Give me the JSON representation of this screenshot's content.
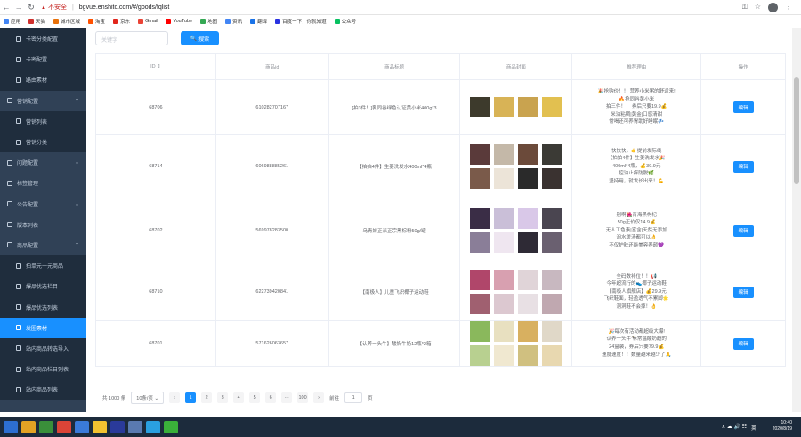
{
  "browser": {
    "insecure_label": "不安全",
    "url": "bgvue.enshitc.com/#/goods/fqlist"
  },
  "bookmarks": [
    "应用",
    "天猫",
    "城市区域",
    "淘宝",
    "京东",
    "Gmail",
    "YouTube",
    "地图",
    "资讯",
    "翻译",
    "百度一下，你就知道",
    "公众号"
  ],
  "sidebar": [
    {
      "label": "卡密分类配置",
      "level": 2
    },
    {
      "label": "卡密配置",
      "level": 2
    },
    {
      "label": "路由素材",
      "level": 2
    },
    {
      "label": "营销配置",
      "level": 1,
      "arrow": "⌃"
    },
    {
      "label": "营销列表",
      "level": 2
    },
    {
      "label": "营销分类",
      "level": 2
    },
    {
      "label": "问题配置",
      "level": 1,
      "arrow": "⌄"
    },
    {
      "label": "标签管理",
      "level": 1
    },
    {
      "label": "公告配置",
      "level": 1,
      "arrow": "⌄"
    },
    {
      "label": "版本列表",
      "level": 1
    },
    {
      "label": "商品配置",
      "level": 1,
      "arrow": "⌃"
    },
    {
      "label": "拍单元一元商品",
      "level": 2
    },
    {
      "label": "爆品优选栏目",
      "level": 2
    },
    {
      "label": "爆品优选列表",
      "level": 2
    },
    {
      "label": "发圈素材",
      "level": 2,
      "active": true
    },
    {
      "label": "站内商品转选导入",
      "level": 2
    },
    {
      "label": "站内商品栏目列表",
      "level": 2
    },
    {
      "label": "站内商品列表",
      "level": 2
    }
  ],
  "search": {
    "placeholder": "关键字",
    "button": "搜索"
  },
  "table": {
    "headers": [
      "ID ⇕",
      "商品id",
      "商品标题",
      "商品封面",
      "推荐理由",
      "操作"
    ],
    "rows": [
      {
        "id": "68706",
        "gid": "610282707167",
        "title": "[拍3件！]乳同谷绿色认证黄小米400g*3",
        "reason": "🎉抢购价！！ 营养小米粥的舒适来!\n🔥抢同谷黄小米\n拍三件！！ 券后只要19.9💰\n米油粘稠|黄金|口感清甜\n常喝还可养胃助好睡眠💤",
        "btn": "编辑",
        "imgs": [
          "#3d3a2c",
          "#d8b356",
          "#c9a34f",
          "#e2c050"
        ]
      },
      {
        "id": "68714",
        "gid": "606988885261",
        "title": "【拍拍4件】生姜洗发水400ml*4瓶",
        "reason": "快快快，👉提前发际线\n【拍拍4件】生姜洗发水🎉\n400ml*4瓶，💰39.9元\n控油止痒防脱🌿\n坚持用，就发长出来！💪",
        "btn": "编辑",
        "imgs": [
          "#5a3a3a",
          "#c4b8a8",
          "#6b4a3a",
          "#3b3a35",
          "#7a5a4a",
          "#ece4d8",
          "#2a2a2a",
          "#3a3230"
        ]
      },
      {
        "id": "68702",
        "gid": "569978283500",
        "title": "乌青娇正派正宗黑棕粉50g/罐",
        "reason": "别啊🌺青海黑枸杞\n50g正价仅14.9💰\n无人工色素|富含|天然无添加\n泡水煲汤都可以👌\n不仅护肤还能美容养颜💜",
        "btn": "编辑",
        "imgs": [
          "#3a2d46",
          "#cabfd8",
          "#d9c8e8",
          "#4a4550",
          "#8a7e98",
          "#efe6f0",
          "#2e2a35",
          "#6a6070"
        ]
      },
      {
        "id": "68710",
        "gid": "622739420841",
        "title": "【南极人】儿童飞织椰子运动鞋",
        "reason": "全码数补位！！📢\n今年超流行的👟椰子运动鞋\n【南极人旗舰店】💰29.9元\n飞织鞋面，轻盈透气不累脚🌟\n洞洞鞋不会掉！👌",
        "btn": "编辑",
        "imgs": [
          "#b0466a",
          "#d8a0b0",
          "#e0d4d8",
          "#c8b8c0",
          "#a06070",
          "#dcc8d0",
          "#e8e0e4",
          "#c0a8b0"
        ]
      },
      {
        "id": "68701",
        "gid": "571626063657",
        "title": "【认养一头牛】酸奶牛奶12瓶*2箱",
        "reason": "🎉每次有活动都超级大爆!\n认养一头牛🐄常温酸奶超的\n24盒装，券后只要79.9💰\n速度速度！！数量越来越少了🙏",
        "btn": "编辑",
        "imgs": [
          "#8ab85c",
          "#e8e0c0",
          "#d8b060",
          "#e0d8c8",
          "#b8d090",
          "#f0e8d0",
          "#d0c080",
          "#e8d8b0"
        ]
      }
    ]
  },
  "pager": {
    "total": "共 1000 条",
    "size": "10条/页",
    "pages": [
      "1",
      "2",
      "3",
      "4",
      "5",
      "6",
      "···",
      "100"
    ],
    "goto": "前往",
    "goto_val": "1",
    "page_unit": "页",
    "prev": "‹",
    "next": "›"
  },
  "taskbar": {
    "time": "10:40",
    "date": "2020/8/19",
    "lang": "英",
    "tray": "∧ ☁ 🔊 ☷"
  }
}
